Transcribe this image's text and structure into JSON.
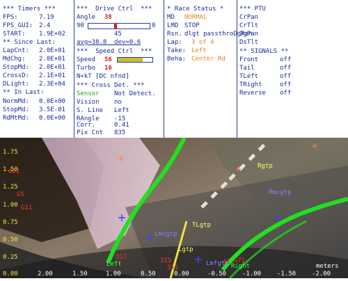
{
  "timers": {
    "header": "*** Timers ***",
    "rows": [
      {
        "label": "FPS:",
        "value": "7.19"
      },
      {
        "label": "FPS_GUI:",
        "value": "2.4"
      },
      {
        "label": "START:",
        "value": "1.9E+02"
      }
    ],
    "since_header": "** Since Last:",
    "since_rows": [
      {
        "label": "LapCnt:",
        "value": "2.0E+01"
      },
      {
        "label": "MdChg:",
        "value": "2.0E+01"
      },
      {
        "label": "StopMd:",
        "value": "2.0E+01"
      },
      {
        "label": "CrossD:",
        "value": "2.1E+01"
      },
      {
        "label": "DLight:",
        "value": "2.3E+04"
      }
    ],
    "in_header": "** In Last:",
    "in_rows": [
      {
        "label": "NormMd:",
        "value": "0.0E+00"
      },
      {
        "label": "StopMd:",
        "value": "3.5E-01"
      },
      {
        "label": "RdMtMd:",
        "value": "0.0E+00"
      }
    ]
  },
  "drive": {
    "header": "***  Drive Ctrl  ***",
    "angle_label": "Angle",
    "angle_value": "38",
    "slider_min": "90",
    "slider_max": "0",
    "slider_fraction": 0.44,
    "slider_mid": "45",
    "avg_dev": "avg=38.8  dev=0.6",
    "speed_header": "***  Speed Ctrl  ***",
    "speed_label": "Speed",
    "speed_value": "56",
    "speed_fraction": 0.72,
    "turbo_label": "Turbo",
    "turbo_value": "16",
    "nkt": "N+kT [DC nfnd]",
    "cross_header": "*** Cross Det. ***",
    "cross_rows": [
      {
        "label": "Sensor",
        "value": "Not Detect.",
        "label_color": "green"
      },
      {
        "label": "Vision",
        "value": "no"
      },
      {
        "label": "S. Line",
        "value": "Left"
      },
      {
        "label": "RAngle",
        "value": "-15"
      },
      {
        "label": "Corr.",
        "value": "0.41"
      },
      {
        "label": "Pix Cnt",
        "value": "835"
      }
    ]
  },
  "race": {
    "header": "* Race Status *",
    "rows": [
      {
        "label": "MD",
        "value": "NORMAL",
        "color": "orange"
      },
      {
        "label": "LMD",
        "value": "STOP",
        "color": "blue"
      },
      {
        "label": "Rsn.",
        "value": "dlgt passthroDgRan",
        "color": "blue"
      },
      {
        "label": "Lap:",
        "value": "3 of 4",
        "color": "orange"
      },
      {
        "label": "Take:",
        "value": "Left",
        "color": "orange"
      },
      {
        "label": "Beha:",
        "value": "Center Rd",
        "color": "orange"
      }
    ]
  },
  "ptu": {
    "header": "*** PTU",
    "items": [
      "CrPan",
      "CrTlt",
      "DgPan",
      "DsTlt"
    ],
    "signals_header": "** SIGNALS **",
    "signals": [
      {
        "label": "Front",
        "value": "off"
      },
      {
        "label": "Tail",
        "value": "off"
      },
      {
        "label": "TLeft",
        "value": "off"
      },
      {
        "label": "TRight",
        "value": "off"
      },
      {
        "label": "Reverse",
        "value": "off"
      }
    ]
  },
  "camera": {
    "y_labels": [
      "1.75",
      "1.50",
      "1.25",
      "1.00",
      "0.75",
      "0.50",
      "0.25",
      "0.00"
    ],
    "x_labels": [
      "2.00",
      "1.50",
      "1.00",
      "0.50",
      "0.00",
      "-0.50",
      "-1.00",
      "-1.50",
      "-2.00"
    ],
    "units": "meters",
    "markers": [
      {
        "label": "Rgtp"
      },
      {
        "label": "Rmcgtp"
      },
      {
        "label": "TLgtp"
      },
      {
        "label": "Lmcgtp"
      },
      {
        "label": "Lgtp"
      },
      {
        "label": "Lmfgtp"
      },
      {
        "label": "Left"
      },
      {
        "label": "Right"
      }
    ],
    "red_labels": [
      "401",
      "G5",
      "G11",
      "317",
      "315",
      "311",
      "41",
      "G71"
    ]
  }
}
